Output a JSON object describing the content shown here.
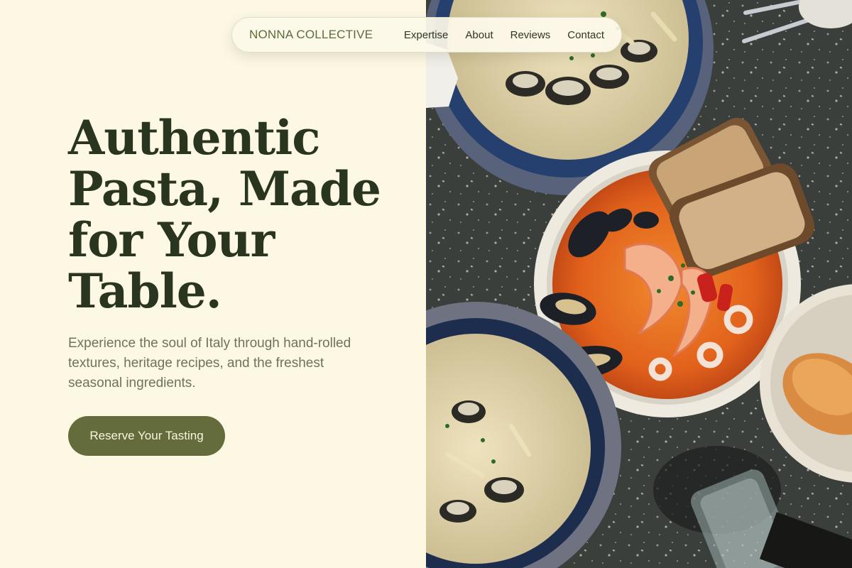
{
  "nav": {
    "brand": "NONNA COLLECTIVE",
    "links": [
      "Expertise",
      "About",
      "Reviews",
      "Contact"
    ]
  },
  "hero": {
    "title_lines": [
      "Authentic",
      "Pasta, Made",
      "for Your",
      "Table."
    ],
    "subtitle": "Experience the soul of Italy through hand-rolled textures, heritage recipes, and the freshest seasonal ingredients.",
    "cta_label": "Reserve Your Tasting"
  },
  "colors": {
    "background": "#fdf8e4",
    "title": "#2a3520",
    "subtitle": "#6d7459",
    "accent": "#646c3c",
    "brand": "#5f6a3c"
  }
}
